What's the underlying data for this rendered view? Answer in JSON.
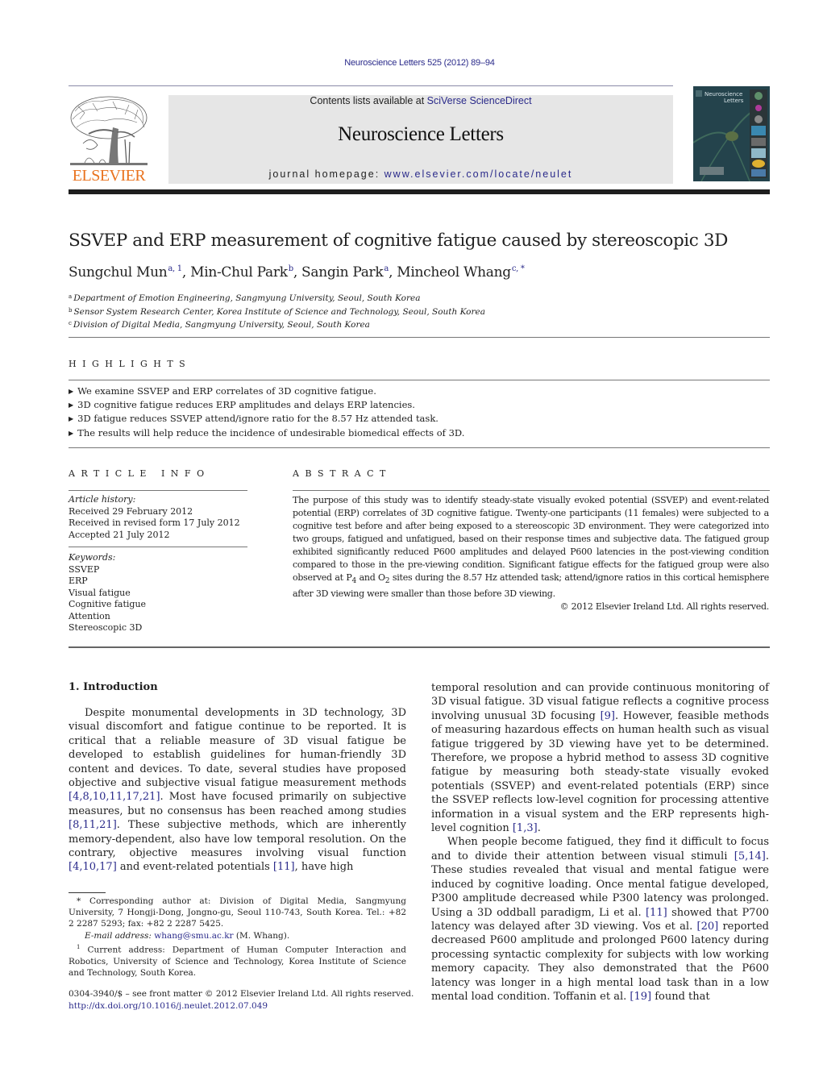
{
  "header": {
    "citation": "Neuroscience Letters 525 (2012) 89–94",
    "contents_prefix": "Contents lists available at ",
    "contents_link": "SciVerse ScienceDirect",
    "journal_title": "Neuroscience Letters",
    "homepage_prefix": "journal homepage: ",
    "homepage_link": "www.elsevier.com/locate/neulet",
    "publisher_logo_text": "ELSEVIER",
    "cover_title_line1": "Neuroscience",
    "cover_title_line2": "Letters"
  },
  "colors": {
    "link": "#2a2a8a",
    "elsevier_orange": "#e9731f",
    "header_box": "#e6e6e6",
    "rule_dark": "#1e1e1e"
  },
  "article": {
    "title": "SSVEP and ERP measurement of cognitive fatigue caused by stereoscopic 3D",
    "authors": [
      {
        "name": "Sungchul Mun",
        "sup": "a, 1",
        "sep": ", "
      },
      {
        "name": "Min-Chul Park",
        "sup": "b",
        "sep": ", "
      },
      {
        "name": "Sangin Park",
        "sup": "a",
        "sep": ", "
      },
      {
        "name": "Mincheol Whang",
        "sup": "c, *",
        "sep": ""
      }
    ],
    "affiliations": [
      {
        "mark": "a",
        "text": "Department of Emotion Engineering, Sangmyung University, Seoul, South Korea"
      },
      {
        "mark": "b",
        "text": "Sensor System Research Center, Korea Institute of Science and Technology, Seoul, South Korea"
      },
      {
        "mark": "c",
        "text": "Division of Digital Media, Sangmyung University, Seoul, South Korea"
      }
    ]
  },
  "highlights": {
    "heading": "HIGHLIGHTS",
    "items": [
      "We examine SSVEP and ERP correlates of 3D cognitive fatigue.",
      "3D cognitive fatigue reduces ERP amplitudes and delays ERP latencies.",
      "3D fatigue reduces SSVEP attend/ignore ratio for the 8.57 Hz attended task.",
      "The results will help reduce the incidence of undesirable biomedical effects of 3D."
    ]
  },
  "article_info": {
    "heading": "ARTICLE INFO",
    "history_label": "Article history:",
    "history": [
      "Received 29 February 2012",
      "Received in revised form 17 July 2012",
      "Accepted 21 July 2012"
    ],
    "keywords_label": "Keywords:",
    "keywords": [
      "SSVEP",
      "ERP",
      "Visual fatigue",
      "Cognitive fatigue",
      "Attention",
      "Stereoscopic 3D"
    ]
  },
  "abstract": {
    "heading": "ABSTRACT",
    "text_part1": "The purpose of this study was to identify steady-state visually evoked potential (SSVEP) and event-related potential (ERP) correlates of 3D cognitive fatigue. Twenty-one participants (11 females) were subjected to a cognitive test before and after being exposed to a stereoscopic 3D environment. They were categorized into two groups, fatigued and unfatigued, based on their response times and subjective data. The fatigued group exhibited significantly reduced P600 amplitudes and delayed P600 latencies in the post-viewing condition compared to those in the pre-viewing condition. Significant fatigue effects for the fatigued group were also observed at P",
    "sub1": "4",
    "text_part2": " and O",
    "sub2": "2",
    "text_part3": " sites during the 8.57 Hz attended task; attend/ignore ratios in this cortical hemisphere after 3D viewing were smaller than those before 3D viewing.",
    "copyright": "© 2012 Elsevier Ireland Ltd. All rights reserved."
  },
  "intro": {
    "heading": "1.  Introduction",
    "left_p1": [
      {
        "t": "Despite monumental developments in 3D technology, 3D visual discomfort and fatigue continue to be reported. It is critical that a reliable measure of 3D visual fatigue be developed to establish guidelines for human-friendly 3D content and devices. To date, several studies have proposed objective and subjective visual fatigue measurement methods "
      },
      {
        "ref": "[4,8,10,11,17,21]"
      },
      {
        "t": ". Most have focused primarily on subjective measures, but no consensus has been reached among studies "
      },
      {
        "ref": "[8,11,21]"
      },
      {
        "t": ". These subjective methods, which are inherently memory-dependent, also have low temporal resolution. On the contrary, objective measures involving visual function "
      },
      {
        "ref": "[4,10,17]"
      },
      {
        "t": " and event-related potentials "
      },
      {
        "ref": "[11]"
      },
      {
        "t": ", have high"
      }
    ],
    "right_p1": [
      {
        "t": "temporal resolution and can provide continuous monitoring of 3D visual fatigue. 3D visual fatigue reflects a cognitive process involving unusual 3D focusing "
      },
      {
        "ref": "[9]"
      },
      {
        "t": ". However, feasible methods of measuring hazardous effects on human health such as visual fatigue triggered by 3D viewing have yet to be determined. Therefore, we propose a hybrid method to assess 3D cognitive fatigue by measuring both steady-state visually evoked potentials (SSVEP) and event-related potentials (ERP) since the SSVEP reflects low-level cognition for processing attentive information in a visual system and the ERP represents high-level cognition "
      },
      {
        "ref": "[1,3]"
      },
      {
        "t": "."
      }
    ],
    "right_p2": [
      {
        "t": "When people become fatigued, they find it difficult to focus and to divide their attention between visual stimuli "
      },
      {
        "ref": "[5,14]"
      },
      {
        "t": ". These studies revealed that visual and mental fatigue were induced by cognitive loading. Once mental fatigue developed, P300 amplitude decreased while P300 latency was prolonged. Using a 3D oddball paradigm, Li et al. "
      },
      {
        "ref": "[11]"
      },
      {
        "t": " showed that P700 latency was delayed after 3D viewing. Vos et al. "
      },
      {
        "ref": "[20]"
      },
      {
        "t": " reported decreased P600 amplitude and prolonged P600 latency during processing syntactic complexity for subjects with low working memory capacity. They also demonstrated that the P600 latency was longer in a high mental load task than in a low mental load condition. Toffanin et al. "
      },
      {
        "ref": "[19]"
      },
      {
        "t": " found that"
      }
    ]
  },
  "footnotes": {
    "corresponding": "* Corresponding author at: Division of Digital Media, Sangmyung University, 7 Hongji-Dong, Jongno-gu, Seoul 110-743, South Korea. Tel.: +82 2 2287 5293; fax: +82 2 2287 5425.",
    "email_label": "E-mail address: ",
    "email": "whang@smu.ac.kr",
    "email_suffix": " (M. Whang).",
    "current_mark": "1",
    "current_address": " Current address: Department of Human Computer Interaction and Robotics, University of Science and Technology, Korea Institute of Science and Technology, South Korea.",
    "issn_line": "0304-3940/$ – see front matter © 2012 Elsevier Ireland Ltd. All rights reserved.",
    "doi": "http://dx.doi.org/10.1016/j.neulet.2012.07.049"
  }
}
